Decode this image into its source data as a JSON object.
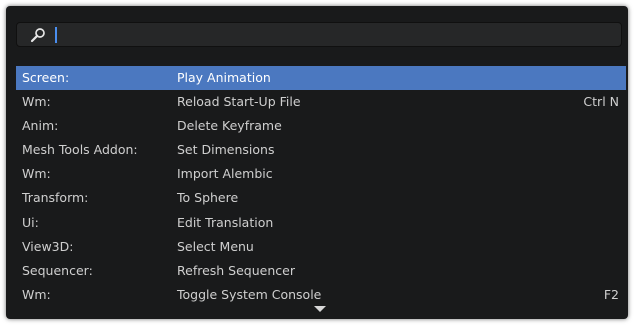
{
  "search": {
    "value": "",
    "placeholder": ""
  },
  "colors": {
    "panel_background": "#191a1b",
    "search_field": "#262728",
    "highlight": "#4b78c0",
    "caret": "#4a8eef",
    "text": "#cfcfcf"
  },
  "icons": {
    "search": "search-icon",
    "scroll": "more-results-down-arrow"
  },
  "results": [
    {
      "category": "Screen:",
      "operator": "Play Animation",
      "shortcut": "",
      "selected": true
    },
    {
      "category": "Wm:",
      "operator": "Reload Start-Up File",
      "shortcut": "Ctrl N",
      "selected": false
    },
    {
      "category": "Anim:",
      "operator": "Delete Keyframe",
      "shortcut": "",
      "selected": false
    },
    {
      "category": "Mesh Tools Addon:",
      "operator": "Set Dimensions",
      "shortcut": "",
      "selected": false
    },
    {
      "category": "Wm:",
      "operator": "Import Alembic",
      "shortcut": "",
      "selected": false
    },
    {
      "category": "Transform:",
      "operator": "To Sphere",
      "shortcut": "",
      "selected": false
    },
    {
      "category": "Ui:",
      "operator": "Edit Translation",
      "shortcut": "",
      "selected": false
    },
    {
      "category": "View3D:",
      "operator": "Select Menu",
      "shortcut": "",
      "selected": false
    },
    {
      "category": "Sequencer:",
      "operator": "Refresh Sequencer",
      "shortcut": "",
      "selected": false
    },
    {
      "category": "Wm:",
      "operator": "Toggle System Console",
      "shortcut": "F2",
      "selected": false
    }
  ]
}
